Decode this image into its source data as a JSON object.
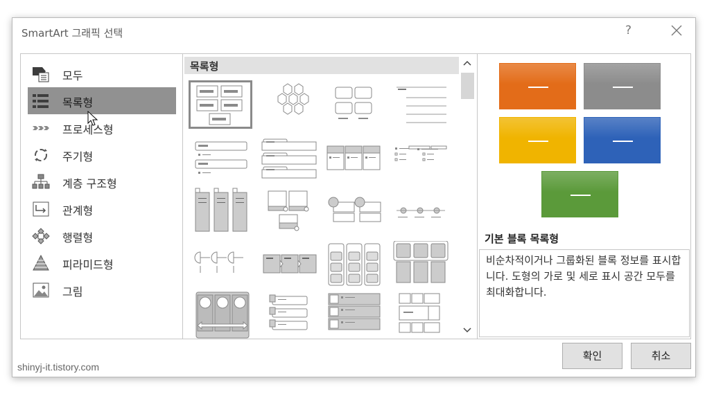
{
  "window": {
    "title": "SmartArt 그래픽 선택",
    "help_glyph": "?"
  },
  "categories": [
    {
      "label": "모두",
      "icon": "all-icon",
      "selected": false
    },
    {
      "label": "목록형",
      "icon": "list-icon",
      "selected": true
    },
    {
      "label": "프로세스형",
      "icon": "process-icon",
      "selected": false
    },
    {
      "label": "주기형",
      "icon": "cycle-icon",
      "selected": false
    },
    {
      "label": "계층 구조형",
      "icon": "hierarchy-icon",
      "selected": false
    },
    {
      "label": "관계형",
      "icon": "relationship-icon",
      "selected": false
    },
    {
      "label": "행렬형",
      "icon": "matrix-icon",
      "selected": false
    },
    {
      "label": "피라미드형",
      "icon": "pyramid-icon",
      "selected": false
    },
    {
      "label": "그림",
      "icon": "picture-icon",
      "selected": false
    }
  ],
  "gallery": {
    "header": "목록형",
    "selected_index": 0
  },
  "preview": {
    "colors": [
      "#e36c19",
      "#8c8c8c",
      "#f0b400",
      "#2e62b8",
      "#5b9a3a"
    ],
    "title": "기본 블록 목록형",
    "description": "비순차적이거나 그룹화된 블록 정보를 표시합니다. 도형의 가로 및 세로 표시 공간 모두를 최대화합니다."
  },
  "buttons": {
    "ok": "확인",
    "cancel": "취소"
  },
  "watermark": "shinyj-it.tistory.com"
}
